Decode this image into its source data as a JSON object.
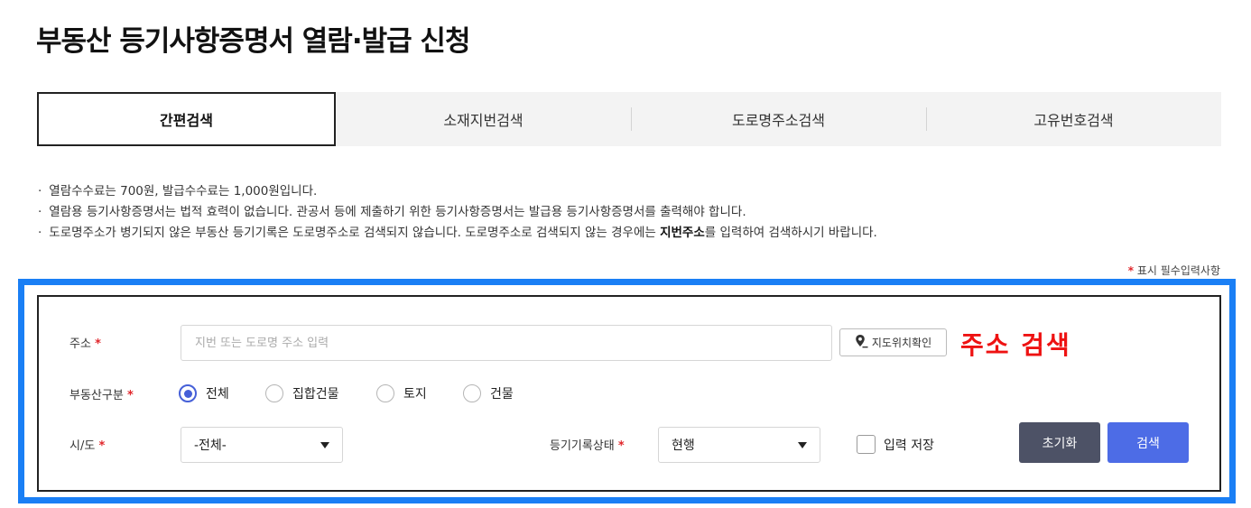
{
  "page": {
    "title": "부동산 등기사항증명서 열람·발급 신청"
  },
  "tabs": [
    {
      "label": "간편검색",
      "active": true
    },
    {
      "label": "소재지번검색",
      "active": false
    },
    {
      "label": "도로명주소검색",
      "active": false
    },
    {
      "label": "고유번호검색",
      "active": false
    }
  ],
  "notices": {
    "bullet": "·",
    "items": [
      "열람수수료는  700원, 발급수수료는  1,000원입니다.",
      "열람용 등기사항증명서는 법적 효력이 없습니다. 관공서 등에 제출하기 위한 등기사항증명서는 발급용 등기사항증명서를 출력해야 합니다."
    ],
    "item3": {
      "before": "도로명주소가 병기되지 않은 부동산 등기기록은 도로명주소로 검색되지 않습니다. 도로명주소로 검색되지 않는 경우에는 ",
      "bold": "지번주소",
      "after": "를 입력하여 검색하시기 바랍니다."
    }
  },
  "required_note": {
    "star": "*",
    "text": " 표시 필수입력사항"
  },
  "form": {
    "address": {
      "label": "주소",
      "star": "*",
      "placeholder": "지번 또는 도로명 주소 입력",
      "value": "",
      "map_button": "지도위치확인"
    },
    "annotation": "주소 검색",
    "property_type": {
      "label": "부동산구분",
      "star": "*",
      "options": [
        {
          "label": "전체",
          "checked": true
        },
        {
          "label": "집합건물",
          "checked": false
        },
        {
          "label": "토지",
          "checked": false
        },
        {
          "label": "건물",
          "checked": false
        }
      ]
    },
    "region": {
      "label": "시/도",
      "star": "*",
      "selected": "-전체-"
    },
    "record_status": {
      "label": "등기기록상태",
      "star": "*",
      "selected": "현행"
    },
    "save_input": {
      "label": "입력 저장",
      "checked": false
    },
    "buttons": {
      "reset": "초기화",
      "search": "검색"
    }
  },
  "colors": {
    "highlight_frame": "#1a7ff5",
    "annotation": "#ee1212",
    "required_star": "#e0262b",
    "radio_accent": "#4660d8",
    "reset_button": "#4d5266",
    "search_button": "#4d6ce6"
  },
  "icons": {
    "map_button_icon": "map-pin-icon",
    "select_caret": "caret-down-icon"
  }
}
